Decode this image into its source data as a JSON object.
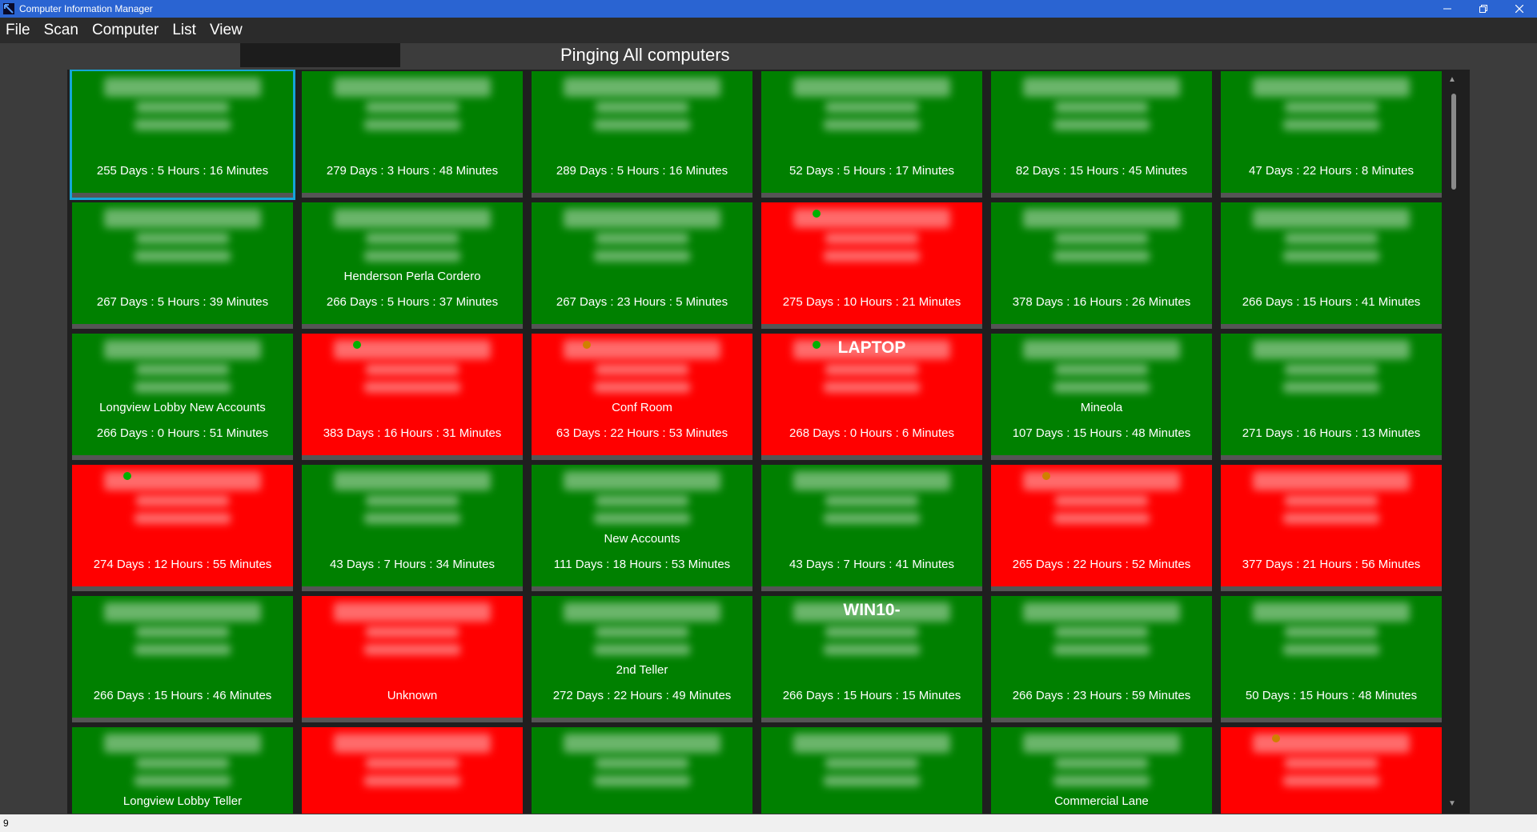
{
  "window": {
    "title": "Computer Information Manager",
    "controls": [
      "minimize",
      "restore",
      "close"
    ]
  },
  "menu": {
    "items": [
      "File",
      "Scan",
      "Computer",
      "List",
      "View"
    ]
  },
  "search": {
    "value": ""
  },
  "header": {
    "status_text": "Pinging All computers"
  },
  "colors": {
    "online": "#008000",
    "offline": "#ff0000",
    "selected_border": "#15a5d8",
    "grid_bg": "#1f1f1f",
    "titlebar": "#2a64d2"
  },
  "tiles": [
    {
      "status": "online",
      "selected": true,
      "name": "",
      "location": "",
      "uptime": "255 Days : 5 Hours : 16 Minutes",
      "dot": ""
    },
    {
      "status": "online",
      "name": "",
      "location": "",
      "uptime": "279 Days : 3 Hours : 48 Minutes",
      "dot": ""
    },
    {
      "status": "online",
      "name": "",
      "location": "",
      "uptime": "289 Days : 5 Hours : 16 Minutes",
      "dot": ""
    },
    {
      "status": "online",
      "name": "",
      "location": "",
      "uptime": "52 Days : 5 Hours : 17 Minutes",
      "dot": ""
    },
    {
      "status": "online",
      "name": "",
      "location": "",
      "uptime": "82 Days : 15 Hours : 45 Minutes",
      "dot": ""
    },
    {
      "status": "online",
      "name": "",
      "location": "",
      "uptime": "47 Days : 22 Hours : 8 Minutes",
      "dot": ""
    },
    {
      "status": "online",
      "name": "",
      "location": "",
      "uptime": "267 Days : 5 Hours : 39 Minutes",
      "dot": ""
    },
    {
      "status": "online",
      "name": "",
      "location": "Henderson Perla Cordero",
      "uptime": "266 Days : 5 Hours : 37 Minutes",
      "dot": ""
    },
    {
      "status": "online",
      "name": "",
      "location": "",
      "uptime": "267 Days : 23 Hours : 5 Minutes",
      "dot": ""
    },
    {
      "status": "offline",
      "name": "",
      "location": "",
      "uptime": "275 Days : 10 Hours : 21 Minutes",
      "dot": "green"
    },
    {
      "status": "online",
      "name": "",
      "location": "",
      "uptime": "378 Days : 16 Hours : 26 Minutes",
      "dot": ""
    },
    {
      "status": "online",
      "name": "",
      "location": "",
      "uptime": "266 Days : 15 Hours : 41 Minutes",
      "dot": ""
    },
    {
      "status": "online",
      "name": "",
      "location": "Longview Lobby New Accounts",
      "uptime": "266 Days : 0 Hours : 51 Minutes",
      "dot": ""
    },
    {
      "status": "offline",
      "name": "",
      "location": "",
      "uptime": "383 Days : 16 Hours : 31 Minutes",
      "dot": "green"
    },
    {
      "status": "offline",
      "name": "",
      "location": "Conf Room",
      "uptime": "63 Days : 22 Hours : 53 Minutes",
      "dot": "orange"
    },
    {
      "status": "offline",
      "name": "LAPTOP",
      "location": "",
      "uptime": "268 Days : 0 Hours : 6 Minutes",
      "dot": "green"
    },
    {
      "status": "online",
      "name": "",
      "location": "Mineola",
      "uptime": "107 Days : 15 Hours : 48 Minutes",
      "dot": ""
    },
    {
      "status": "online",
      "name": "",
      "location": "",
      "uptime": "271 Days : 16 Hours : 13 Minutes",
      "dot": ""
    },
    {
      "status": "offline",
      "name": "",
      "location": "",
      "uptime": "274 Days : 12 Hours : 55 Minutes",
      "dot": "green"
    },
    {
      "status": "online",
      "name": "",
      "location": "",
      "uptime": "43 Days : 7 Hours : 34 Minutes",
      "dot": ""
    },
    {
      "status": "online",
      "name": "",
      "location": "New Accounts",
      "uptime": "111 Days : 18 Hours : 53 Minutes",
      "dot": ""
    },
    {
      "status": "online",
      "name": "",
      "location": "",
      "uptime": "43 Days : 7 Hours : 41 Minutes",
      "dot": ""
    },
    {
      "status": "offline",
      "name": "",
      "location": "",
      "uptime": "265 Days : 22 Hours : 52 Minutes",
      "dot": "orange"
    },
    {
      "status": "offline",
      "name": "",
      "location": "",
      "uptime": "377 Days : 21 Hours : 56 Minutes",
      "dot": ""
    },
    {
      "status": "online",
      "name": "",
      "location": "",
      "uptime": "266 Days : 15 Hours : 46 Minutes",
      "dot": ""
    },
    {
      "status": "offline",
      "name": "",
      "location": "",
      "uptime": "Unknown",
      "dot": ""
    },
    {
      "status": "online",
      "name": "",
      "location": "2nd Teller",
      "uptime": "272 Days : 22 Hours : 49 Minutes",
      "dot": ""
    },
    {
      "status": "online",
      "name": "WIN10-",
      "location": "",
      "uptime": "266 Days : 15 Hours : 15 Minutes",
      "dot": ""
    },
    {
      "status": "online",
      "name": "",
      "location": "",
      "uptime": "266 Days : 23 Hours : 59 Minutes",
      "dot": ""
    },
    {
      "status": "online",
      "name": "",
      "location": "",
      "uptime": "50 Days : 15 Hours : 48 Minutes",
      "dot": ""
    },
    {
      "status": "online",
      "name": "",
      "location": "Longview Lobby Teller",
      "uptime": "",
      "dot": ""
    },
    {
      "status": "offline",
      "name": "",
      "location": "",
      "uptime": "",
      "dot": ""
    },
    {
      "status": "online",
      "name": "",
      "location": "",
      "uptime": "",
      "dot": ""
    },
    {
      "status": "online",
      "name": "",
      "location": "",
      "uptime": "",
      "dot": ""
    },
    {
      "status": "online",
      "name": "",
      "location": "Commercial Lane",
      "uptime": "",
      "dot": ""
    },
    {
      "status": "offline",
      "name": "",
      "location": "",
      "uptime": "",
      "dot": "orange"
    }
  ],
  "statusbar": {
    "text": "9"
  }
}
